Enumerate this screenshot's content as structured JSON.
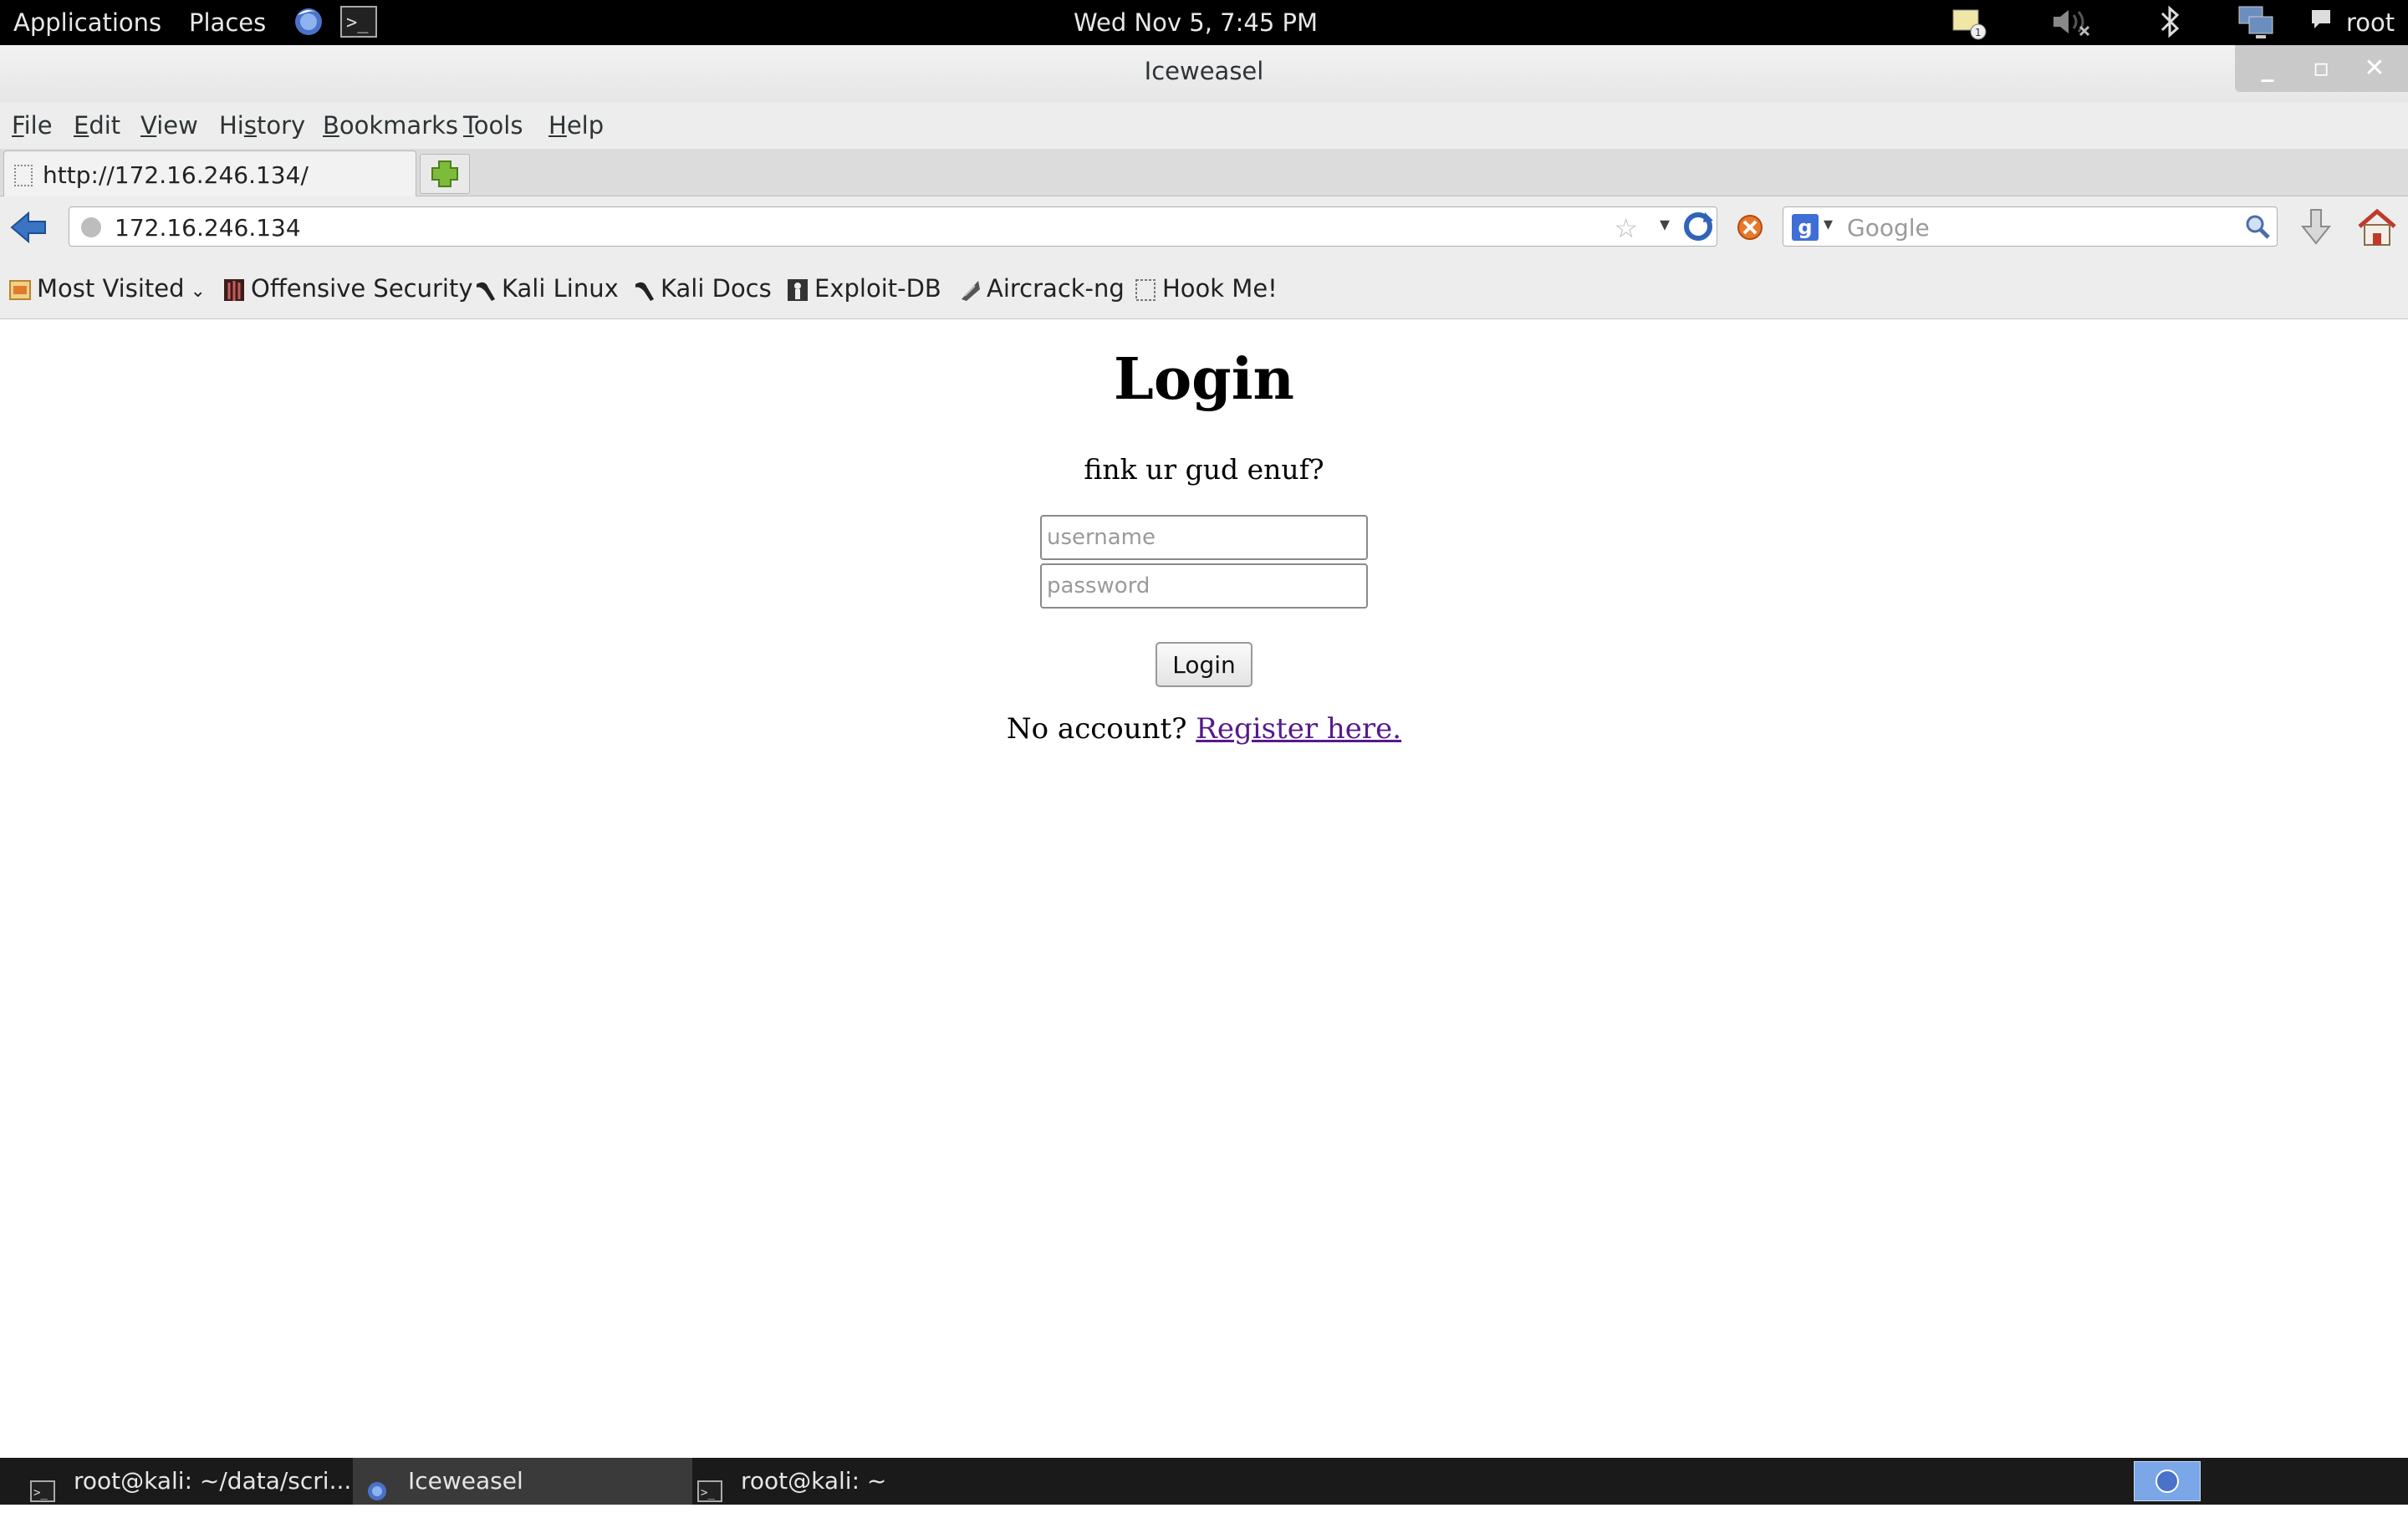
{
  "top_panel": {
    "applications": "Applications",
    "places": "Places",
    "clock": "Wed Nov  5,  7:45 PM",
    "user": "root",
    "icons": [
      "browser-icon",
      "terminal-icon",
      "notification-icon",
      "volume-muted-icon",
      "bluetooth-icon",
      "network-icon",
      "chat-icon"
    ]
  },
  "window": {
    "title": "Iceweasel"
  },
  "menu": {
    "items": [
      {
        "label": "File",
        "mnemonic": "F",
        "rest": "ile"
      },
      {
        "label": "Edit",
        "mnemonic": "E",
        "rest": "dit"
      },
      {
        "label": "View",
        "mnemonic": "V",
        "rest": "iew"
      },
      {
        "label": "History",
        "mnemonic": "s",
        "pre": "Hi",
        "rest": "tory"
      },
      {
        "label": "Bookmarks",
        "mnemonic": "B",
        "rest": "ookmarks"
      },
      {
        "label": "Tools",
        "mnemonic": "T",
        "rest": "ools"
      },
      {
        "label": "Help",
        "mnemonic": "H",
        "rest": "elp"
      }
    ]
  },
  "tabs": [
    {
      "label": "http://172.16.246.134/",
      "active": true
    }
  ],
  "navbar": {
    "url": "172.16.246.134",
    "search_placeholder": "Google",
    "search_engine_letter": "g"
  },
  "bookmarks": [
    {
      "label": "Most Visited",
      "icon": "most-visited-icon",
      "dropdown": true
    },
    {
      "label": "Offensive Security",
      "icon": "offsec-icon"
    },
    {
      "label": "Kali Linux",
      "icon": "kali-dragon-icon"
    },
    {
      "label": "Kali Docs",
      "icon": "kali-dragon-icon"
    },
    {
      "label": "Exploit-DB",
      "icon": "exploit-db-icon"
    },
    {
      "label": "Aircrack-ng",
      "icon": "aircrack-icon"
    },
    {
      "label": "Hook Me!",
      "icon": "blank-page-icon"
    }
  ],
  "page": {
    "title": "Login",
    "tagline": "fink ur gud enuf?",
    "username_placeholder": "username",
    "password_placeholder": "password",
    "login_button": "Login",
    "register_prompt": "No account?",
    "register_link": "Register here."
  },
  "taskbar": {
    "tasks": [
      {
        "label": "root@kali: ~/data/scri...",
        "icon": "terminal-icon"
      },
      {
        "label": "Iceweasel",
        "icon": "iceweasel-icon",
        "active": true
      },
      {
        "label": "root@kali: ~",
        "icon": "terminal-icon"
      }
    ]
  },
  "colors": {
    "link_visited": "#551a8b",
    "panel_bg": "#000000",
    "workspace_active": "#7ba7e8"
  }
}
